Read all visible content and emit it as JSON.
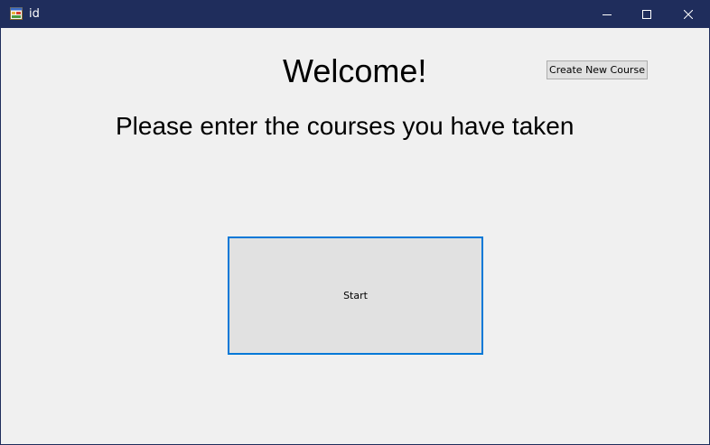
{
  "window": {
    "title": "id",
    "icon": "app-form-icon",
    "controls": {
      "minimize": "minimize-icon",
      "maximize": "maximize-icon",
      "close": "close-icon"
    }
  },
  "main": {
    "welcome_text": "Welcome!",
    "prompt_text": "Please enter the courses you have taken",
    "create_course_label": "Create New Course",
    "start_label": "Start"
  },
  "colors": {
    "titlebar": "#1f2d5c",
    "client_background": "#f0f0f0",
    "button_face": "#e1e1e1",
    "focus_border": "#0078d7"
  }
}
